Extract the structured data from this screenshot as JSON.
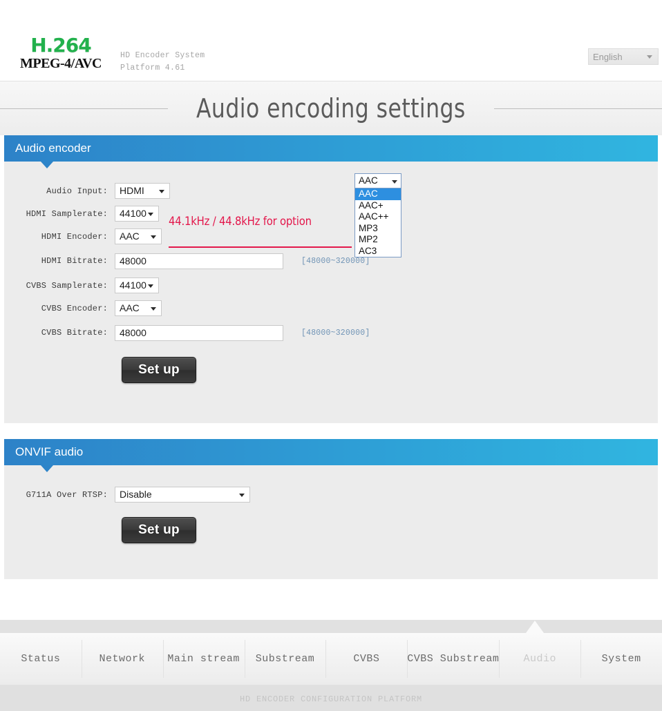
{
  "header": {
    "logo_top": "H.264",
    "logo_bottom": "MPEG-4/AVC",
    "system_line1": "HD Encoder System",
    "system_line2": "Platform 4.61",
    "language": "English"
  },
  "page_title": "Audio encoding settings",
  "audio_encoder": {
    "section_title": "Audio encoder",
    "warning": "44.1kHz / 44.8kHz for option",
    "rows": [
      {
        "label": "Audio Input:",
        "type": "select",
        "value": "HDMI"
      },
      {
        "label": "HDMI Samplerate:",
        "type": "select",
        "value": "44100"
      },
      {
        "label": "HDMI Encoder:",
        "type": "select",
        "value": "AAC"
      },
      {
        "label": "HDMI Bitrate:",
        "type": "input",
        "value": "48000",
        "hint": "[48000~320000]"
      },
      {
        "label": "CVBS Samplerate:",
        "type": "select",
        "value": "44100"
      },
      {
        "label": "CVBS Encoder:",
        "type": "select",
        "value": "AAC"
      },
      {
        "label": "CVBS Bitrate:",
        "type": "input",
        "value": "48000",
        "hint": "[48000~320000]"
      }
    ],
    "setup_label": "Set up"
  },
  "encoder_dropdown": {
    "selected": "AAC",
    "options": [
      "AAC",
      "AAC+",
      "AAC++",
      "MP3",
      "MP2",
      "AC3"
    ]
  },
  "onvif": {
    "section_title": "ONVIF audio",
    "label": "G711A Over RTSP:",
    "value": "Disable",
    "setup_label": "Set up"
  },
  "nav": {
    "items": [
      {
        "label": "Status",
        "active": false
      },
      {
        "label": "Network",
        "active": false
      },
      {
        "label": "Main stream",
        "active": false
      },
      {
        "label": "Substream",
        "active": false
      },
      {
        "label": "CVBS",
        "active": false
      },
      {
        "label": "CVBS Substream",
        "active": false
      },
      {
        "label": "Audio",
        "active": true
      },
      {
        "label": "System",
        "active": false
      }
    ]
  },
  "footer": "HD ENCODER CONFIGURATION PLATFORM",
  "colors": {
    "brand_green": "#22b14c",
    "panel_blue_left": "#2d82c8",
    "panel_blue_right": "#30b5e0",
    "warning_red": "#e3174b",
    "hint_blue": "#6f93b5",
    "dropdown_highlight": "#2d8fe0"
  }
}
